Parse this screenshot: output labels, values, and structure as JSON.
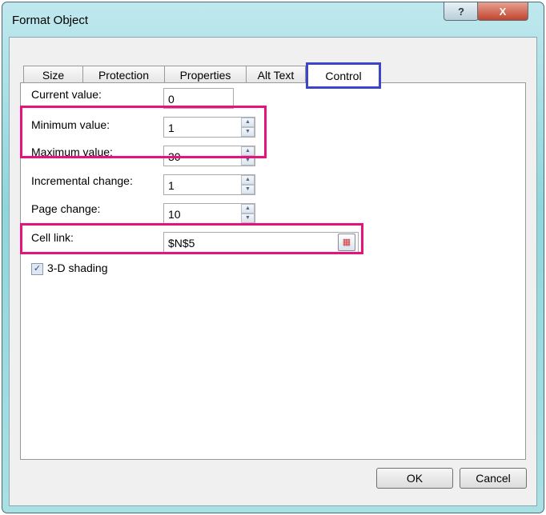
{
  "window": {
    "title": "Format Object",
    "help_icon": "?",
    "close_icon": "X"
  },
  "tabs": [
    "Size",
    "Protection",
    "Properties",
    "Alt Text",
    "Control"
  ],
  "active_tab": "Control",
  "fields": [
    {
      "label": "Current value:",
      "value": "0"
    },
    {
      "label": "Minimum value:",
      "value": "1"
    },
    {
      "label": "Maximum value:",
      "value": "30"
    },
    {
      "label": "Incremental change:",
      "value": "1"
    },
    {
      "label": "Page change:",
      "value": "10"
    },
    {
      "label": "Cell link:",
      "value": "$N$5"
    }
  ],
  "shading": {
    "label": "3-D shading",
    "checked": true
  },
  "buttons": {
    "ok": "OK",
    "cancel": "Cancel"
  },
  "colors": {
    "highlight": "#e6137d",
    "tab_highlight": "#3d45c8"
  }
}
